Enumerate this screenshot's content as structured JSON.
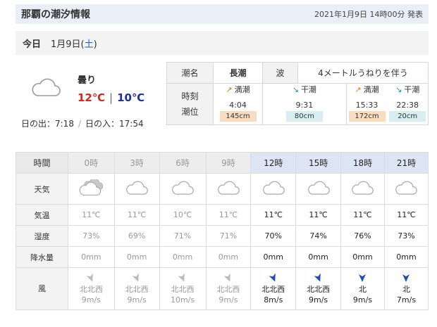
{
  "header": {
    "title": "那覇の潮汐情報",
    "issued": "2021年1月9日 14時00分 発表"
  },
  "date": {
    "today": "今日",
    "date": "1月9日(",
    "weekday": "土",
    "close": ")"
  },
  "summary": {
    "icon": "cloud-icon",
    "condition": "曇り",
    "high": "12℃",
    "sep": "|",
    "low": "10℃",
    "sunrise": "日の出：7:18",
    "sunset": "日の入：17:54",
    "slash": "/"
  },
  "tide": {
    "name_label": "潮名",
    "name_value": "長潮",
    "wave_label": "波",
    "wave_value": "4メートルうねりを伴う",
    "time_label": "時刻",
    "level_label": "潮位",
    "events": [
      {
        "type": "満潮",
        "direction": "up",
        "time": "4:04",
        "level": "145cm"
      },
      {
        "type": "干潮",
        "direction": "down",
        "time": "9:31",
        "level": "80cm"
      },
      {
        "type": "満潮",
        "direction": "up",
        "time": "15:33",
        "level": "172cm"
      },
      {
        "type": "干潮",
        "direction": "down",
        "time": "22:38",
        "level": "20cm"
      }
    ],
    "colors": {
      "high_bg": "#f7dcbf",
      "low_bg": "#d8eef0",
      "up_arrow": "#e07b1f",
      "down_arrow": "#2a8ba3"
    }
  },
  "hourly": {
    "labels": {
      "time": "時間",
      "weather": "天気",
      "temp": "気温",
      "humidity": "湿度",
      "precip": "降水量",
      "wind": "風"
    },
    "hours": [
      {
        "time": "0時",
        "past": true,
        "icon": "partly-cloudy-icon",
        "temp": "11℃",
        "humidity": "73%",
        "precip": "0mm",
        "wind_dir": "北北西",
        "wind_speed": "9m/s"
      },
      {
        "time": "3時",
        "past": true,
        "icon": "cloud-icon",
        "temp": "11℃",
        "humidity": "69%",
        "precip": "0mm",
        "wind_dir": "北北西",
        "wind_speed": "9m/s"
      },
      {
        "time": "6時",
        "past": true,
        "icon": "cloud-icon",
        "temp": "10℃",
        "humidity": "71%",
        "precip": "0mm",
        "wind_dir": "北北西",
        "wind_speed": "10m/s"
      },
      {
        "time": "9時",
        "past": true,
        "icon": "cloud-icon",
        "temp": "11℃",
        "humidity": "71%",
        "precip": "0mm",
        "wind_dir": "北北西",
        "wind_speed": "9m/s"
      },
      {
        "time": "12時",
        "past": false,
        "icon": "cloud-icon",
        "temp": "11℃",
        "humidity": "70%",
        "precip": "0mm",
        "wind_dir": "北北西",
        "wind_speed": "8m/s"
      },
      {
        "time": "15時",
        "past": false,
        "icon": "cloud-icon",
        "temp": "11℃",
        "humidity": "74%",
        "precip": "0mm",
        "wind_dir": "北北西",
        "wind_speed": "9m/s"
      },
      {
        "time": "18時",
        "past": false,
        "icon": "cloud-icon",
        "temp": "11℃",
        "humidity": "76%",
        "precip": "0mm",
        "wind_dir": "北",
        "wind_speed": "9m/s"
      },
      {
        "time": "21時",
        "past": false,
        "icon": "cloud-icon",
        "temp": "11℃",
        "humidity": "73%",
        "precip": "0mm",
        "wind_dir": "北",
        "wind_speed": "7m/s"
      }
    ],
    "colors": {
      "past_text": "#999999",
      "future_header_bg": "#dde5f5",
      "wind_arrow_future": "#1f4fb6",
      "wind_arrow_past": "#bbbbbb"
    }
  }
}
